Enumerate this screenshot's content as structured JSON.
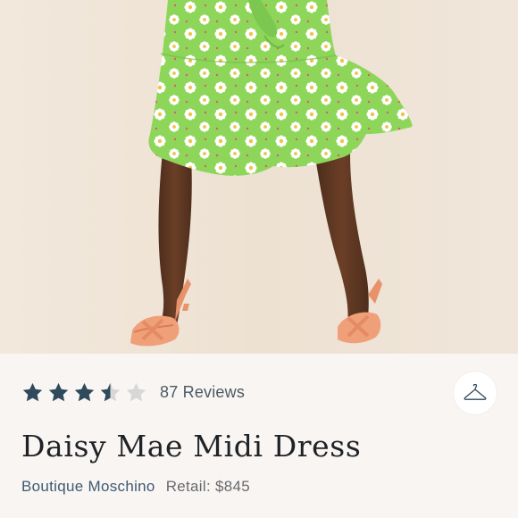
{
  "product": {
    "image_alt": "Green daisy print midi dress with orange heeled sandals",
    "rating": {
      "value": 3.5,
      "max": 5,
      "star_color": "#2f4a5c",
      "empty_color": "#d7d7d7"
    },
    "reviews_label": "87 Reviews",
    "title": "Daisy Mae Midi Dress",
    "brand": "Boutique Moschino",
    "retail": "Retail: $845"
  },
  "icons": {
    "closet": "hanger-icon",
    "star": "star-icon"
  },
  "colors": {
    "dress_green": "#8ed65a",
    "sandal_orange": "#f0a078",
    "background": "#f9f5f2"
  }
}
